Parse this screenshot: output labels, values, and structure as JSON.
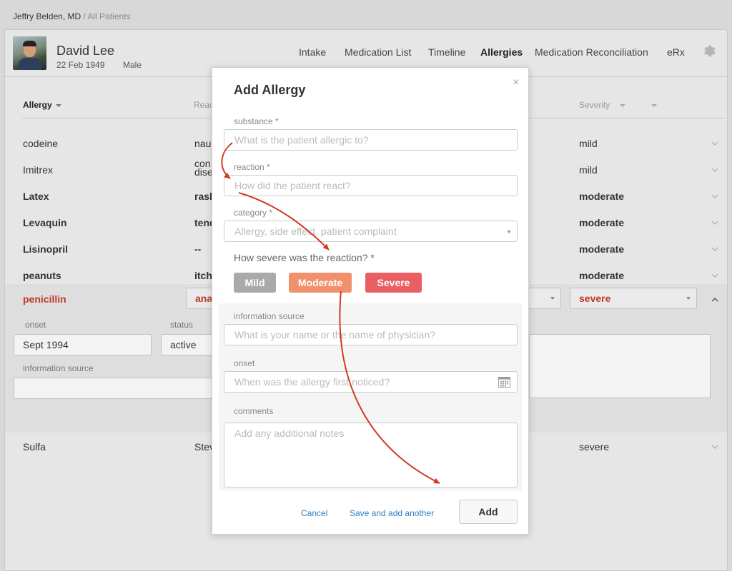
{
  "breadcrumb": {
    "user": "Jeffry Belden, MD",
    "sep": " / ",
    "link": "All Patients"
  },
  "patient": {
    "name": "David Lee",
    "dob": "22 Feb 1949",
    "sex": "Male"
  },
  "nav": {
    "tabs": [
      "Intake",
      "Medication List",
      "Timeline",
      "Allergies",
      "Medication Reconciliation",
      "eRx"
    ],
    "active": "Allergies"
  },
  "table": {
    "headers": {
      "allergy": "Allergy",
      "reaction": "Reac",
      "severity": "Severity"
    },
    "rows": [
      {
        "allergy": "codeine",
        "reaction": "nau",
        "reaction2": "",
        "severity": "mild",
        "bold": false
      },
      {
        "allergy": "Imitrex",
        "reaction": "con",
        "reaction2": "dise",
        "severity": "mild",
        "bold": false
      },
      {
        "allergy": "Latex",
        "reaction": "rasl",
        "reaction2": "",
        "severity": "moderate",
        "bold": true
      },
      {
        "allergy": "Levaquin",
        "reaction": "tend",
        "reaction2": "",
        "severity": "moderate",
        "bold": true
      },
      {
        "allergy": "Lisinopril",
        "reaction": "--",
        "reaction2": "",
        "severity": "moderate",
        "bold": true
      },
      {
        "allergy": "peanuts",
        "reaction": "itch",
        "reaction2": "",
        "severity": "moderate",
        "bold": true
      }
    ],
    "expanded": {
      "allergy": "penicillin",
      "reaction": "ana",
      "severity": "severe",
      "onset_label": "onset",
      "onset_value": "Sept 1994",
      "status_label": "status",
      "status_value": "active",
      "info_label": "information source"
    },
    "last_row": {
      "allergy": "Sulfa",
      "reaction": "Stev",
      "severity": "severe"
    }
  },
  "modal": {
    "title": "Add Allergy",
    "close": "×",
    "substance_label": "substance *",
    "substance_placeholder": "What is the patient allergic to?",
    "reaction_label": "reaction *",
    "reaction_placeholder": "How did the patient react?",
    "category_label": "category *",
    "category_placeholder": "Allergy, side effect, patient complaint",
    "severity_question": "How severe was the reaction? *",
    "severity_buttons": [
      {
        "label": "Mild",
        "color": "#aaaaaa"
      },
      {
        "label": "Moderate",
        "color": "#f0916c"
      },
      {
        "label": "Severe",
        "color": "#ea5f61"
      }
    ],
    "info_label": "information source",
    "info_placeholder": "What is your name or the name of physician?",
    "onset_label": "onset",
    "onset_placeholder": "When was the allergy first noticed?",
    "comments_label": "comments",
    "comments_placeholder": "Add any additional notes",
    "cancel": "Cancel",
    "save_another": "Save and add another",
    "add": "Add"
  },
  "colors": {
    "accent_red": "#c0392b",
    "link_blue": "#2a7fc4",
    "arrow_red": "#d13b26"
  }
}
